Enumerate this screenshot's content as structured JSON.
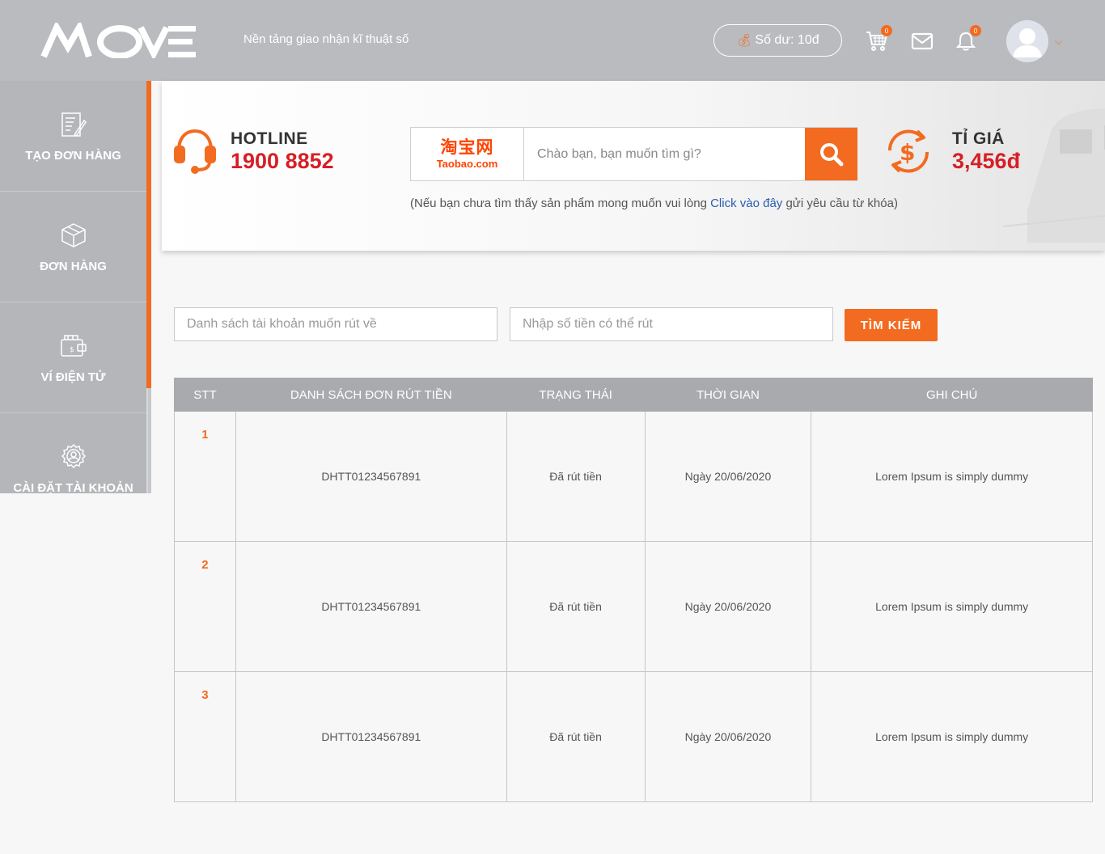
{
  "header": {
    "logo_text": "MOVE",
    "tagline": "Nền tảng giao nhận kĩ thuật số",
    "balance": "Số dư: 10đ",
    "cart_count": "0",
    "notification_count": "0",
    "icons": [
      "cart-icon",
      "mail-icon",
      "bell-icon",
      "user-avatar",
      "chevron-down-icon"
    ]
  },
  "sidebar": {
    "items": [
      {
        "label": "TẠO ĐƠN HÀNG",
        "icon": "create-order-icon"
      },
      {
        "label": "ĐƠN HÀNG",
        "icon": "box-icon"
      },
      {
        "label": "VÍ ĐIỆN TỬ",
        "icon": "wallet-icon"
      },
      {
        "label": "CÀI ĐẶT TÀI KHOẢN",
        "icon": "account-settings-icon"
      }
    ],
    "accent_color": "#f26b21"
  },
  "banner": {
    "hotline_label": "HOTLINE",
    "hotline_number": "1900 8852",
    "taobao_cn": "淘宝网",
    "taobao_domain": "Taobao.com",
    "search_placeholder": "Chào bạn, bạn muốn tìm gì?",
    "hint_before": "(Nếu bạn chưa tìm thấy sản phẩm mong muốn vui lòng ",
    "hint_link": "Click vào đây",
    "hint_after": " gửi yêu cầu từ khóa)",
    "rate_label": "TỈ GIÁ",
    "rate_value": "3,456đ"
  },
  "filter": {
    "account_placeholder": "Danh sách tài khoản muốn rút về",
    "amount_placeholder": "Nhập số tiền có thể rút",
    "search_button": "TÌM KIẾM"
  },
  "table": {
    "columns": [
      "STT",
      "DANH SÁCH ĐƠN RÚT TIỀN",
      "TRẠNG THÁI",
      "THỜI GIAN",
      "GHI CHÚ"
    ],
    "rows": [
      {
        "stt": "1",
        "order": "DHTT01234567891",
        "status": "Đã rút tiền",
        "time": "Ngày 20/06/2020",
        "note": "Lorem Ipsum is simply dummy"
      },
      {
        "stt": "2",
        "order": "DHTT01234567891",
        "status": "Đã rút tiền",
        "time": "Ngày 20/06/2020",
        "note": "Lorem Ipsum is simply dummy"
      },
      {
        "stt": "3",
        "order": "DHTT01234567891",
        "status": "Đã rút tiền",
        "time": "Ngày 20/06/2020",
        "note": "Lorem Ipsum is simply dummy"
      }
    ]
  },
  "colors": {
    "brand_orange": "#f26b21",
    "header_gray": "#b9bbbf",
    "hotline_red": "#d61f26",
    "link_blue": "#2a5db0"
  }
}
